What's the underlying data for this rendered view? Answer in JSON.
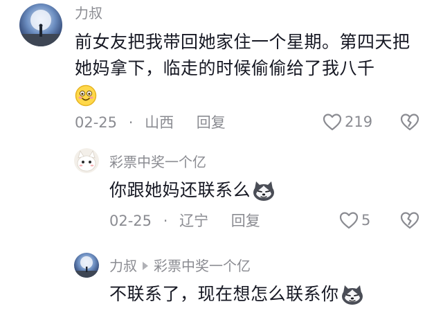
{
  "comments": [
    {
      "username": "力叔",
      "text": "前女友把我带回她家住一个星期。第四天把她妈拿下，临走的时候偷偷给了我八千",
      "emoji": "smiling-face-emoji",
      "date": "02-25",
      "location": "山西",
      "reply_label": "回复",
      "likes": "219"
    }
  ],
  "replies": [
    {
      "username": "彩票中奖一个亿",
      "text": "你跟她妈还联系么",
      "emoji": "husky-dog-emoji",
      "date": "02-25",
      "location": "辽宁",
      "reply_label": "回复",
      "likes": "5"
    },
    {
      "username": "力叔",
      "reply_to": "彩票中奖一个亿",
      "text": "不联系了，现在想怎么联系你",
      "emoji": "husky-dog-emoji"
    }
  ],
  "separator": "·",
  "icons": {
    "like": "heart-outline-icon",
    "dislike": "broken-heart-icon",
    "reply_arrow": "triangle-right-icon"
  },
  "colors": {
    "text": "#161823",
    "muted": "#8a8b91"
  }
}
